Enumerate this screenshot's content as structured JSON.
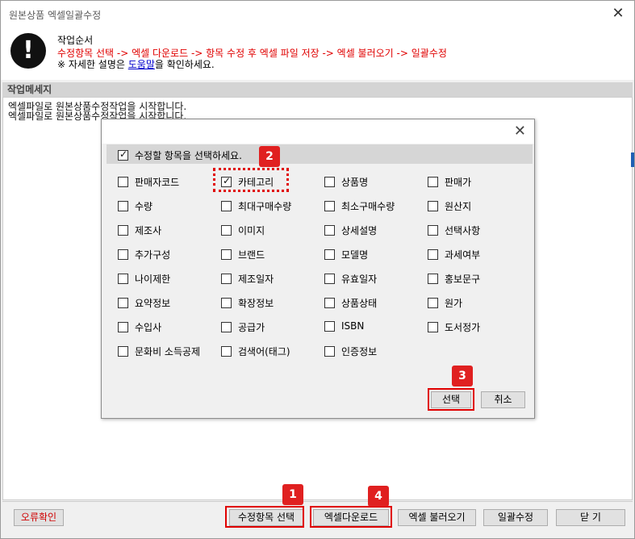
{
  "window": {
    "title": "원본상품 엑셀일괄수정",
    "close_glyph": "✕"
  },
  "guide": {
    "icon": "exclamation-icon",
    "heading": "작업순서",
    "steps": "수정항목 선택 -> 엑셀 다운로드 -> 항목 수정 후 엑셀 파일 저장 -> 엑셀 불러오기 -> 일괄수정",
    "note_prefix": "※ 자세한 설명은 ",
    "note_link": "도움말",
    "note_suffix": "을 확인하세요."
  },
  "log": {
    "header": "작업메세지",
    "lines": [
      "엑셀파일로 원본상품수정작업을 시작합니다.",
      "엑셀파일로 원본상품수정작업을 시작합니다."
    ]
  },
  "footer": {
    "error_check": "오류확인",
    "select_items": "수정항목 선택",
    "excel_download": "엑셀다운로드",
    "excel_load": "엑셀 불러오기",
    "bulk_edit": "일괄수정",
    "close": "닫 기"
  },
  "dialog": {
    "close_glyph": "✕",
    "select_all_label": "수정할 항목을 선택하세요.",
    "select_all_checked": true,
    "ok": "선택",
    "cancel": "취소",
    "items": [
      {
        "label": "판매자코드",
        "checked": false
      },
      {
        "label": "카테고리",
        "checked": true
      },
      {
        "label": "상품명",
        "checked": false
      },
      {
        "label": "판매가",
        "checked": false
      },
      {
        "label": "수량",
        "checked": false
      },
      {
        "label": "최대구매수량",
        "checked": false
      },
      {
        "label": "최소구매수량",
        "checked": false
      },
      {
        "label": "원산지",
        "checked": false
      },
      {
        "label": "제조사",
        "checked": false
      },
      {
        "label": "이미지",
        "checked": false
      },
      {
        "label": "상세설명",
        "checked": false
      },
      {
        "label": "선택사항",
        "checked": false
      },
      {
        "label": "추가구성",
        "checked": false
      },
      {
        "label": "브랜드",
        "checked": false
      },
      {
        "label": "모델명",
        "checked": false
      },
      {
        "label": "과세여부",
        "checked": false
      },
      {
        "label": "나이제한",
        "checked": false
      },
      {
        "label": "제조일자",
        "checked": false
      },
      {
        "label": "유효일자",
        "checked": false
      },
      {
        "label": "홍보문구",
        "checked": false
      },
      {
        "label": "요약정보",
        "checked": false
      },
      {
        "label": "확장정보",
        "checked": false
      },
      {
        "label": "상품상태",
        "checked": false
      },
      {
        "label": "원가",
        "checked": false
      },
      {
        "label": "수입사",
        "checked": false
      },
      {
        "label": "공급가",
        "checked": false
      },
      {
        "label": "ISBN",
        "checked": false
      },
      {
        "label": "도서정가",
        "checked": false
      },
      {
        "label": "문화비 소득공제",
        "checked": false
      },
      {
        "label": "검색어(태그)",
        "checked": false
      },
      {
        "label": "인증정보",
        "checked": false
      }
    ]
  },
  "annotations": [
    "1",
    "2",
    "3",
    "4"
  ],
  "colors": {
    "annotation": "#e00000",
    "steps_text": "#e00000",
    "link": "#0000cc"
  }
}
